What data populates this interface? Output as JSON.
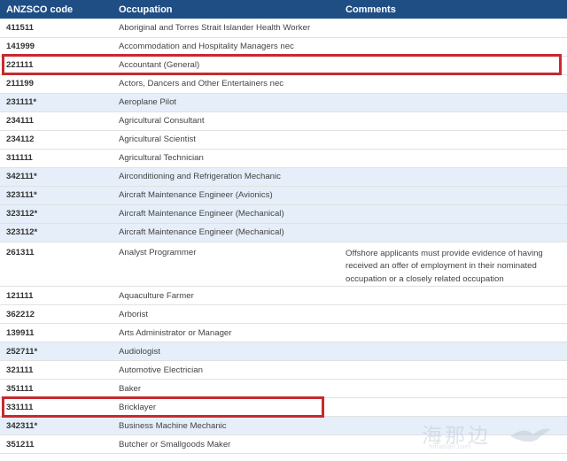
{
  "table": {
    "headers": {
      "code": "ANZSCO code",
      "occupation": "Occupation",
      "comments": "Comments"
    },
    "rows": [
      {
        "code": "411511",
        "occupation": "Aboriginal and Torres Strait Islander Health Worker",
        "comments": "",
        "alt": false,
        "highlight": false
      },
      {
        "code": "141999",
        "occupation": "Accommodation and Hospitality Managers nec",
        "comments": "",
        "alt": false,
        "highlight": false
      },
      {
        "code": "221111",
        "occupation": "Accountant (General)",
        "comments": "",
        "alt": false,
        "highlight": true
      },
      {
        "code": "211199",
        "occupation": "Actors, Dancers and Other Entertainers nec",
        "comments": "",
        "alt": false,
        "highlight": false
      },
      {
        "code": "231111*",
        "occupation": "Aeroplane Pilot",
        "comments": "",
        "alt": true,
        "highlight": false
      },
      {
        "code": "234111",
        "occupation": "Agricultural Consultant",
        "comments": "",
        "alt": false,
        "highlight": false
      },
      {
        "code": "234112",
        "occupation": "Agricultural Scientist",
        "comments": "",
        "alt": false,
        "highlight": false
      },
      {
        "code": "311111",
        "occupation": "Agricultural Technician",
        "comments": "",
        "alt": false,
        "highlight": false
      },
      {
        "code": "342111*",
        "occupation": "Airconditioning and Refrigeration Mechanic",
        "comments": "",
        "alt": true,
        "highlight": false
      },
      {
        "code": "323111*",
        "occupation": "Aircraft Maintenance Engineer (Avionics)",
        "comments": "",
        "alt": true,
        "highlight": false
      },
      {
        "code": "323112*",
        "occupation": "Aircraft Maintenance Engineer (Mechanical)",
        "comments": "",
        "alt": true,
        "highlight": false
      },
      {
        "code": "323112*",
        "occupation": "Aircraft Maintenance Engineer (Mechanical)",
        "comments": "",
        "alt": true,
        "highlight": false
      },
      {
        "code": "261311",
        "occupation": "Analyst Programmer",
        "comments": "Offshore applicants must provide evidence of having received an offer of employment in their nominated occupation or a closely related occupation",
        "alt": false,
        "highlight": false,
        "tall": true
      },
      {
        "code": "121111",
        "occupation": "Aquaculture Farmer",
        "comments": "",
        "alt": false,
        "highlight": false
      },
      {
        "code": "362212",
        "occupation": "Arborist",
        "comments": "",
        "alt": false,
        "highlight": false
      },
      {
        "code": "139911",
        "occupation": "Arts Administrator or Manager",
        "comments": "",
        "alt": false,
        "highlight": false
      },
      {
        "code": "252711*",
        "occupation": "Audiologist",
        "comments": "",
        "alt": true,
        "highlight": false
      },
      {
        "code": "321111",
        "occupation": "Automotive Electrician",
        "comments": "",
        "alt": false,
        "highlight": false
      },
      {
        "code": "351111",
        "occupation": "Baker",
        "comments": "",
        "alt": false,
        "highlight": false
      },
      {
        "code": "331111",
        "occupation": "Bricklayer",
        "comments": "",
        "alt": false,
        "highlight": true
      },
      {
        "code": "342311*",
        "occupation": "Business Machine Mechanic",
        "comments": "",
        "alt": true,
        "highlight": false
      },
      {
        "code": "351211",
        "occupation": "Butcher or Smallgoods Maker",
        "comments": "",
        "alt": false,
        "highlight": false
      }
    ]
  },
  "colors": {
    "header_bg": "#1f4e85",
    "alt_row_bg": "#e6eef9",
    "highlight": "#c72a2f"
  },
  "watermark": {
    "text": "海那边",
    "sub": "hinabian.com",
    "icon": "bird-logo-icon"
  }
}
